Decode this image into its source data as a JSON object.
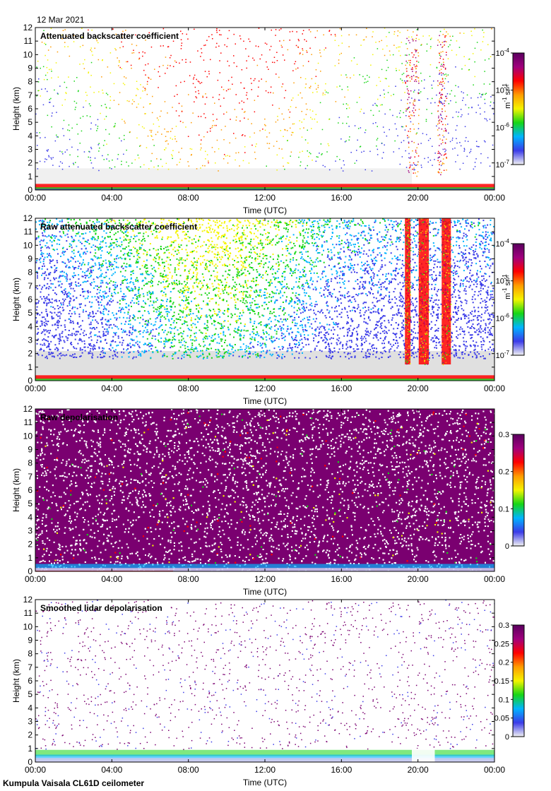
{
  "date_label": "12 Mar 2021",
  "footer": "Kumpula Vaisala CL61D ceilometer",
  "colormap": [
    "#f2f2f2",
    "#3b3be8",
    "#00b4ff",
    "#16d616",
    "#f4f400",
    "#ff9c00",
    "#ff0000",
    "#a0007d",
    "#5a005e"
  ],
  "chart_data": [
    {
      "type": "heatmap",
      "title": "Attenuated backscatter coefficient",
      "xlabel": "Time (UTC)",
      "ylabel": "Height (km)",
      "x_ticks": [
        "00:00",
        "04:00",
        "08:00",
        "12:00",
        "16:00",
        "20:00",
        "00:00"
      ],
      "y_ticks": [
        0,
        1,
        2,
        3,
        4,
        5,
        6,
        7,
        8,
        9,
        10,
        11,
        12
      ],
      "ylim": [
        0,
        12
      ],
      "colorbar": {
        "scale": "log",
        "range": [
          1e-07,
          0.0001
        ],
        "tick_labels": [
          "10",
          "10",
          "10",
          "10"
        ],
        "tick_exponents": [
          "-7",
          "-6",
          "-5",
          "-4"
        ],
        "units": "m",
        "units_exp": "-1",
        "units_b": " sr",
        "units_b_exp": "-1"
      }
    },
    {
      "type": "heatmap",
      "title": "Raw attenuated backscatter coefficient",
      "xlabel": "Time (UTC)",
      "ylabel": "Height (km)",
      "x_ticks": [
        "00:00",
        "04:00",
        "08:00",
        "12:00",
        "16:00",
        "20:00",
        "00:00"
      ],
      "y_ticks": [
        0,
        1,
        2,
        3,
        4,
        5,
        6,
        7,
        8,
        9,
        10,
        11,
        12
      ],
      "ylim": [
        0,
        12
      ],
      "colorbar": {
        "scale": "log",
        "range": [
          1e-07,
          0.0001
        ],
        "tick_labels": [
          "10",
          "10",
          "10",
          "10"
        ],
        "tick_exponents": [
          "-7",
          "-6",
          "-5",
          "-4"
        ],
        "units": "m",
        "units_exp": "-1",
        "units_b": " sr",
        "units_b_exp": "-1"
      }
    },
    {
      "type": "heatmap",
      "title": "Raw depolarisation",
      "xlabel": "Time (UTC)",
      "ylabel": "Height (km)",
      "x_ticks": [
        "00:00",
        "04:00",
        "08:00",
        "12:00",
        "16:00",
        "20:00",
        "00:00"
      ],
      "y_ticks": [
        0,
        1,
        2,
        3,
        4,
        5,
        6,
        7,
        8,
        9,
        10,
        11,
        12
      ],
      "ylim": [
        0,
        12
      ],
      "colorbar": {
        "scale": "linear",
        "range": [
          0,
          0.3
        ],
        "tick_labels": [
          "0",
          "0.1",
          "0.2",
          "0.3"
        ]
      }
    },
    {
      "type": "heatmap",
      "title": "Smoothed lidar depolarisation",
      "xlabel": "Time (UTC)",
      "ylabel": "Height (km)",
      "x_ticks": [
        "00:00",
        "04:00",
        "08:00",
        "12:00",
        "16:00",
        "20:00",
        "00:00"
      ],
      "y_ticks": [
        0,
        1,
        2,
        3,
        4,
        5,
        6,
        7,
        8,
        9,
        10,
        11,
        12
      ],
      "ylim": [
        0,
        12
      ],
      "colorbar": {
        "scale": "linear",
        "range": [
          0,
          0.3
        ],
        "tick_labels": [
          "0",
          "0.05",
          "0.1",
          "0.15",
          "0.2",
          "0.25",
          "0.3"
        ]
      }
    }
  ]
}
